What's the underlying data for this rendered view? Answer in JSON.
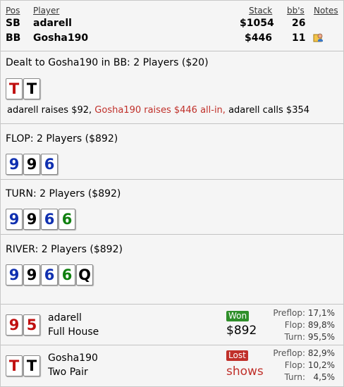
{
  "header": {
    "pos": "Pos",
    "player": "Player",
    "stack": "Stack",
    "bbs": "bb's",
    "notes": "Notes"
  },
  "players": [
    {
      "pos": "SB",
      "name": "adarell",
      "stack": "$1054",
      "bbs": "26",
      "note_icon": ""
    },
    {
      "pos": "BB",
      "name": "Gosha190",
      "stack": "$446",
      "bbs": "11",
      "note_icon": "note-icon"
    }
  ],
  "preflop": {
    "title": "Dealt to Gosha190 in BB: 2 Players ($20)",
    "cards": [
      {
        "rank": "T",
        "color": "red"
      },
      {
        "rank": "T",
        "color": "black"
      }
    ],
    "action_1": "adarell raises $92,",
    "action_2": "Gosha190 raises $446 all-in,",
    "action_3": "adarell calls $354"
  },
  "flop": {
    "title": "FLOP: 2 Players ($892)",
    "cards": [
      {
        "rank": "9",
        "color": "blue"
      },
      {
        "rank": "9",
        "color": "black"
      },
      {
        "rank": "6",
        "color": "blue"
      }
    ]
  },
  "turn": {
    "title": "TURN: 2 Players ($892)",
    "cards": [
      {
        "rank": "9",
        "color": "blue"
      },
      {
        "rank": "9",
        "color": "black"
      },
      {
        "rank": "6",
        "color": "blue"
      },
      {
        "rank": "6",
        "color": "green"
      }
    ]
  },
  "river": {
    "title": "RIVER: 2 Players ($892)",
    "cards": [
      {
        "rank": "9",
        "color": "blue"
      },
      {
        "rank": "9",
        "color": "black"
      },
      {
        "rank": "6",
        "color": "blue"
      },
      {
        "rank": "6",
        "color": "green"
      },
      {
        "rank": "Q",
        "color": "black"
      }
    ]
  },
  "results": [
    {
      "name": "adarell",
      "hand": "Full House",
      "cards": [
        {
          "rank": "9",
          "color": "red"
        },
        {
          "rank": "5",
          "color": "red"
        }
      ],
      "badge": "Won",
      "amount": "$892",
      "stats": {
        "preflop_label": "Preflop:",
        "preflop": "17,1%",
        "flop_label": "Flop:",
        "flop": "89,8%",
        "turn_label": "Turn:",
        "turn": "95,5%"
      }
    },
    {
      "name": "Gosha190",
      "hand": "Two Pair",
      "cards": [
        {
          "rank": "T",
          "color": "red"
        },
        {
          "rank": "T",
          "color": "black"
        }
      ],
      "badge": "Lost",
      "amount": "shows",
      "stats": {
        "preflop_label": "Preflop:",
        "preflop": "82,9%",
        "flop_label": "Flop:",
        "flop": "10,2%",
        "turn_label": "Turn:",
        "turn": "4,5%"
      }
    }
  ],
  "colors": {
    "red": "#c01010",
    "blue": "#1030b0",
    "black": "#000000",
    "green": "#108010",
    "won": "#2f8f2a",
    "lost": "#c0302a"
  }
}
